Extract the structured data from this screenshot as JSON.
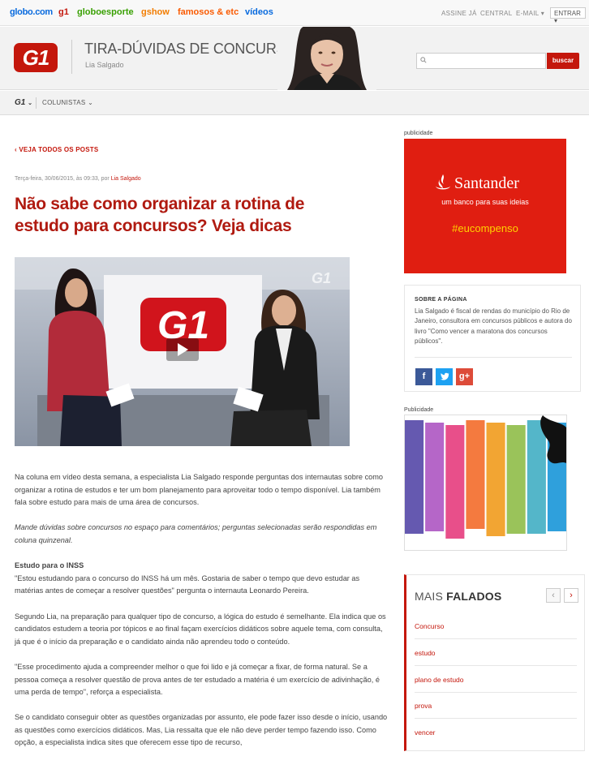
{
  "topbar": {
    "links": [
      {
        "label": "globo.com",
        "color": "#0669de"
      },
      {
        "label": "g1",
        "color": "#c4170c"
      },
      {
        "label": "globoesporte",
        "color": "#39a003"
      },
      {
        "label": "gshow",
        "color": "#f27c00"
      },
      {
        "label": "famosos & etc",
        "color": "#fa5a00"
      },
      {
        "label": "vídeos",
        "color": "#0669de"
      }
    ],
    "assine": "ASSINE JÁ",
    "central": "CENTRAL",
    "email": "E-MAIL",
    "entrar": "ENTRAR"
  },
  "header": {
    "logo": "G1",
    "blog_title": "TIRA-DÚVIDAS DE CONCURSOS",
    "author": "Lia Salgado",
    "search_placeholder": "",
    "search_button": "buscar"
  },
  "nav": {
    "g1": "G1",
    "colunistas": "COLUNISTAS"
  },
  "post": {
    "back_link": "VEJA TODOS OS POSTS",
    "date": "Terça-feira, 30/06/2015, às 09:33, por",
    "author": "Lia Salgado",
    "title": "Não sabe como organizar a rotina de estudo para concursos? Veja dicas",
    "video_logo": "G1",
    "paragraphs": [
      "Na coluna em vídeo desta semana, a especialista Lia Salgado responde perguntas dos internautas sobre como organizar a rotina de estudos e ter um bom planejamento para aproveitar todo o tempo disponível. Lia também fala sobre estudo para mais de uma área de concursos.",
      "Mande dúvidas sobre concursos no espaço para comentários; perguntas selecionadas serão respondidas em coluna quinzenal.",
      "\"Estou estudando para o concurso do INSS há um mês. Gostaria de saber o tempo que devo estudar as matérias antes de começar a resolver questões\" pergunta o internauta Leonardo Pereira.",
      "Segundo Lia, na preparação para qualquer tipo de concurso, a lógica do estudo é semelhante. Ela indica que os candidatos estudem a teoria por tópicos e ao final façam exercícios didáticos sobre aquele tema, com consulta, já que é o início da preparação e o candidato ainda não aprendeu todo o conteúdo.",
      "\"Esse procedimento ajuda a compreender melhor o que foi lido e já começar a fixar, de forma natural. Se a pessoa começa a resolver questão de prova antes de ter estudado a matéria é um exercício de adivinhação, é uma perda de tempo\", reforça a especialista.",
      "Se o candidato conseguir obter as questões organizadas por assunto, ele pode fazer isso desde o início, usando as questões como exercícios didáticos. Mas, Lia ressalta que ele não deve perder tempo fazendo isso. Como opção, a especialista indica sites que oferecem esse tipo de recurso,"
    ],
    "subheading": "Estudo para o INSS"
  },
  "sidebar": {
    "pub_label": "publicidade",
    "ad1": {
      "brand": "Santander",
      "slogan": "um banco para suas ideias",
      "tag": "#eucompenso"
    },
    "about_title": "SOBRE A PÁGINA",
    "about_text": "Lia Salgado é fiscal de rendas do município do Rio de Janeiro, consultora em concursos públicos e autora do livro \"Como vencer a maratona dos concursos públicos\".",
    "social": [
      {
        "icon": "f",
        "color": "#3b5998"
      },
      {
        "icon": "t",
        "color": "#1da1f2"
      },
      {
        "icon": "g+",
        "color": "#dd4b39"
      }
    ],
    "pub_label2": "Publicidade",
    "ad2_colors": [
      "#6559b0",
      "#b566c8",
      "#e84f8a",
      "#f47a3f",
      "#f2a533",
      "#9ac35a",
      "#54b6c9",
      "#2fa0dc"
    ],
    "mais": {
      "title_light": "MAIS",
      "title_bold": "FALADOS",
      "items": [
        "Concurso",
        "estudo",
        "plano de estudo",
        "prova",
        "vencer"
      ]
    }
  }
}
